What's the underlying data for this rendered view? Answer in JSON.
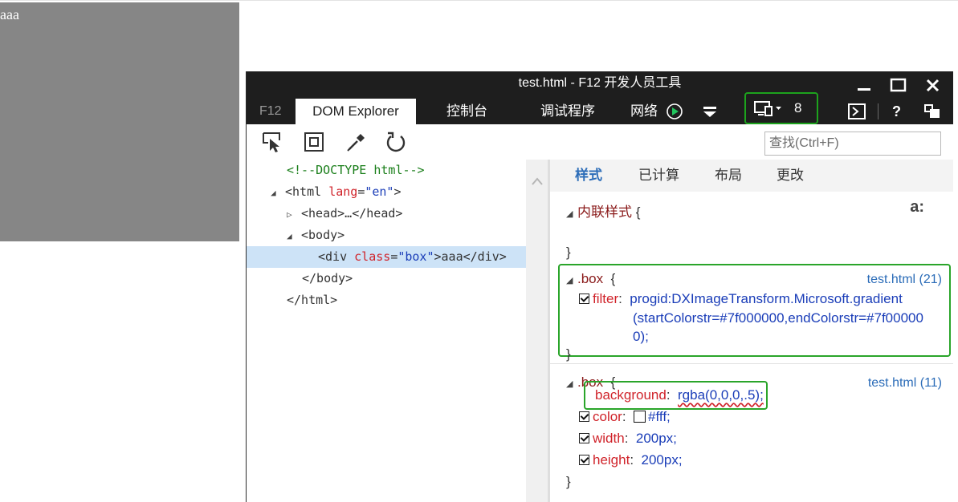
{
  "page": {
    "box_text": "aaa"
  },
  "window": {
    "title": "test.html - F12 开发人员工具"
  },
  "tabs": {
    "f12": "F12",
    "dom_explorer": "DOM Explorer",
    "console": "控制台",
    "debugger": "调试程序",
    "network": "网络",
    "emulation_count": "8"
  },
  "toolbar": {
    "find_placeholder": "查找(Ctrl+F)"
  },
  "dom": {
    "doctype": "<!--DOCTYPE html-->",
    "html_open": "<html",
    "html_attr": "lang",
    "html_eq": "=",
    "html_val": "\"en\"",
    "html_close_bracket": ">",
    "head": "<head>…</head>",
    "body_open": "<body>",
    "div_open": "<div",
    "div_attr": "class",
    "div_eq": "=",
    "div_val": "\"box\"",
    "div_close_bracket": ">",
    "div_text": "aaa",
    "div_end": "</div>",
    "body_close": "</body>",
    "html_close": "</html>"
  },
  "styles": {
    "tabs": [
      "样式",
      "已计算",
      "布局",
      "更改"
    ],
    "pseudo_toggle": "a:",
    "inline": {
      "label": "内联样式",
      "open": "{",
      "close": "}"
    },
    "rule1": {
      "selector": ".box",
      "open": "{",
      "source": "test.html (21)",
      "prop": "filter",
      "value_line1": "progid:DXImageTransform.Microsoft.gradient",
      "value_line2": "(startColorstr=#7f000000,endColorstr=#7f00000",
      "value_line3": "0);",
      "close": "}"
    },
    "rule2": {
      "selector": ".box",
      "open": "{",
      "source": "test.html (11)",
      "props": [
        {
          "name": "background",
          "value": "rgba(0,0,0,.5);"
        },
        {
          "name": "color",
          "value": "#fff;"
        },
        {
          "name": "width",
          "value": "200px;"
        },
        {
          "name": "height",
          "value": "200px;"
        }
      ],
      "close": "}"
    }
  },
  "colors": {
    "accent_green": "#2aa52a",
    "title_bar": "#1e1e1e",
    "link_blue": "#2b6cb8"
  }
}
